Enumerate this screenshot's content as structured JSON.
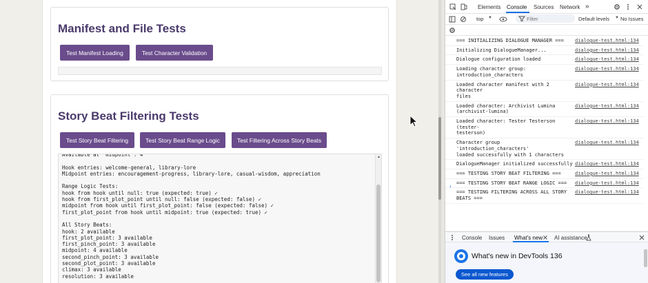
{
  "manifest_section": {
    "title": "Manifest and File Tests",
    "buttons": [
      "Test Manifest Loading",
      "Test Character Validation"
    ]
  },
  "story_section": {
    "title": "Story Beat Filtering Tests",
    "buttons": [
      "Test Story Beat Filtering",
      "Test Story Beat Range Logic",
      "Test Filtering Across Story Beats"
    ],
    "log": "Available at 'midpoint': 4\n\nHook entries: welcome-general, library-lore\nMidpoint entries: encouragement-progress, library-lore, casual-wisdom, appreciation\n\nRange Logic Tests:\nhook from hook until null: true (expected: true) ✓\nhook from first_plot_point until null: false (expected: false) ✓\nmidpoint from hook until first_plot_point: false (expected: false) ✓\nfirst_plot_point from hook until midpoint: true (expected: true) ✓\n\nAll Story Beats:\nhook: 2 available\nfirst_plot_point: 3 available\nfirst_pinch_point: 3 available\nmidpoint: 4 available\nsecond_pinch_point: 3 available\nsecond_plot_point: 3 available\nclimax: 3 available\nresolution: 3 available"
  },
  "devtools": {
    "tabs": [
      "Elements",
      "Console",
      "Sources",
      "Network"
    ],
    "more_tabs": "»",
    "context": "top",
    "filter_placeholder": "Filter",
    "levels": "Default levels",
    "issues": "No Issues",
    "messages": [
      {
        "text": "=== INITIALIZING DIALOGUE MANAGER ===",
        "src": "dialogue-test.html:134"
      },
      {
        "text": "Initializing DialogueManager...",
        "src": "dialogue-test.html:134"
      },
      {
        "text": "Dialogue configuration loaded",
        "src": "dialogue-test.html:134"
      },
      {
        "text": "Loading character group:\nintroduction_characters",
        "src": "dialogue-test.html:134"
      },
      {
        "text": "Loaded character manifest with 2 character\nfiles",
        "src": "dialogue-test.html:134"
      },
      {
        "text": "Loaded character: Archivist Lumina\n(archivist-lumina)",
        "src": "dialogue-test.html:134"
      },
      {
        "text": "Loaded character: Tester Testerson (tester-\ntesterson)",
        "src": "dialogue-test.html:134"
      },
      {
        "text": "Character group 'introduction_characters'\nloaded successfully with 1 characters",
        "src": "dialogue-test.html:134"
      },
      {
        "text": "DialogueManager initialized successfully",
        "src": "dialogue-test.html:134"
      },
      {
        "text": "=== TESTING STORY BEAT FILTERING ===",
        "src": "dialogue-test.html:134"
      },
      {
        "text": "=== TESTING STORY BEAT RANGE LOGIC ===",
        "src": "dialogue-test.html:134"
      },
      {
        "text": "=== TESTING FILTERING ACROSS ALL STORY\nBEATS ===",
        "src": "dialogue-test.html:134"
      }
    ],
    "prompt": "›",
    "drawer_tabs": [
      "Console",
      "Issues",
      "What's new",
      "AI assistance"
    ],
    "whats_new_title": "What's new in DevTools 136",
    "whats_new_button": "See all new features",
    "colors": {
      "accent": "#1a73e8",
      "button": "#6a4c8c",
      "heading": "#4a3a6b"
    }
  }
}
